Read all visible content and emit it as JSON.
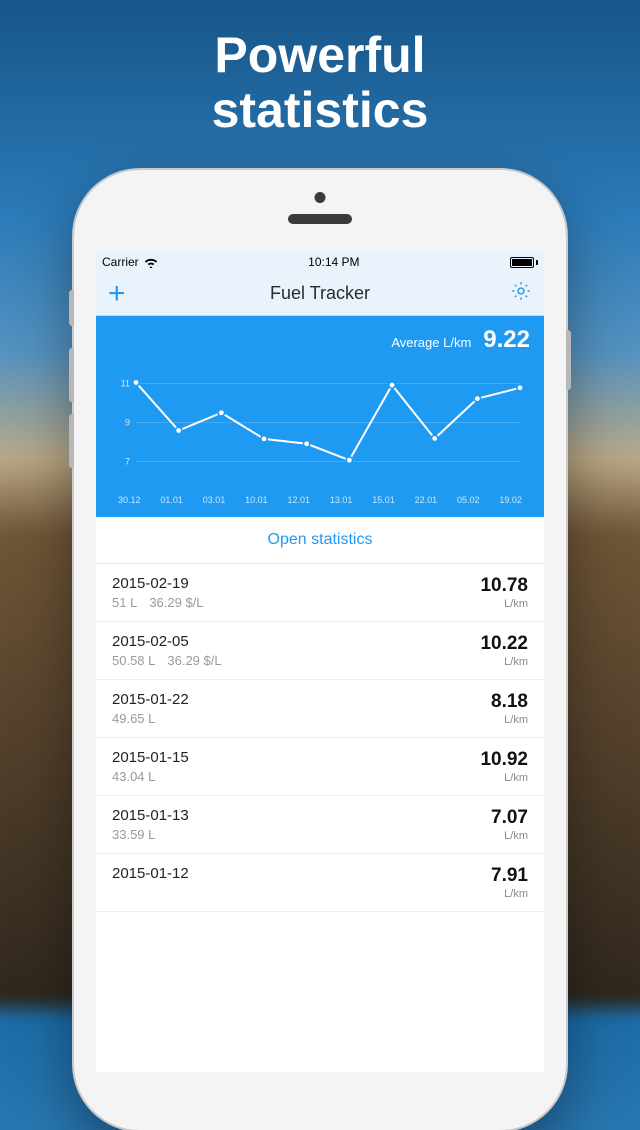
{
  "hero": {
    "line1": "Powerful",
    "line2": "statistics"
  },
  "statusbar": {
    "carrier": "Carrier",
    "time": "10:14 PM"
  },
  "navbar": {
    "title": "Fuel Tracker"
  },
  "average": {
    "label": "Average L/km",
    "value": "9.22"
  },
  "open_statistics_label": "Open statistics",
  "unit_label": "L/km",
  "chart_data": {
    "type": "line",
    "title": "",
    "xlabel": "",
    "ylabel": "L/km",
    "ylim": [
      6,
      12
    ],
    "y_ticks": [
      7,
      9,
      11
    ],
    "categories": [
      "30.12",
      "01.01",
      "03.01",
      "10.01",
      "12.01",
      "13.01",
      "15.01",
      "22.01",
      "05.02",
      "19.02"
    ],
    "values": [
      11.05,
      8.59,
      9.5,
      8.16,
      7.91,
      7.07,
      10.92,
      8.18,
      10.22,
      10.78
    ]
  },
  "entries": [
    {
      "date": "2015-02-19",
      "liters": "51 L",
      "price": "36.29 $/L",
      "value": "10.78"
    },
    {
      "date": "2015-02-05",
      "liters": "50.58 L",
      "price": "36.29 $/L",
      "value": "10.22"
    },
    {
      "date": "2015-01-22",
      "liters": "49.65 L",
      "price": "",
      "value": "8.18"
    },
    {
      "date": "2015-01-15",
      "liters": "43.04 L",
      "price": "",
      "value": "10.92"
    },
    {
      "date": "2015-01-13",
      "liters": "33.59 L",
      "price": "",
      "value": "7.07"
    },
    {
      "date": "2015-01-12",
      "liters": "",
      "price": "",
      "value": "7.91"
    }
  ]
}
